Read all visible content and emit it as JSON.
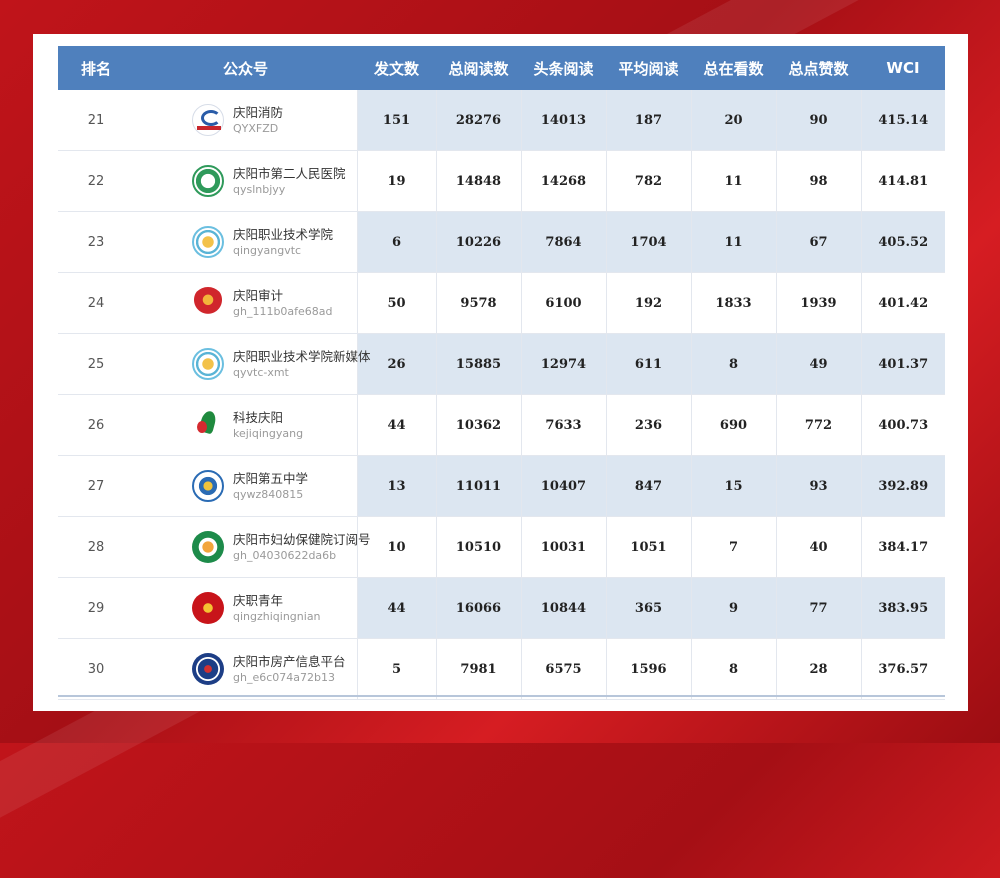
{
  "table": {
    "headers": {
      "rank": "排名",
      "account": "公众号",
      "posts": "发文数",
      "total_reads": "总阅读数",
      "headline_reads": "头条阅读",
      "avg_reads": "平均阅读",
      "total_watching": "总在看数",
      "total_likes": "总点赞数",
      "wci": "WCI"
    },
    "rows": [
      {
        "rank": "21",
        "name": "庆阳消防",
        "id": "QYXFZD",
        "posts": "151",
        "total_reads": "28276",
        "headline_reads": "14013",
        "avg_reads": "187",
        "total_watching": "20",
        "total_likes": "90",
        "wci": "415.14",
        "logo": "fire-dept-logo"
      },
      {
        "rank": "22",
        "name": "庆阳市第二人民医院",
        "id": "qyslnbjyy",
        "posts": "19",
        "total_reads": "14848",
        "headline_reads": "14268",
        "avg_reads": "782",
        "total_watching": "11",
        "total_likes": "98",
        "wci": "414.81",
        "logo": "hospital-logo"
      },
      {
        "rank": "23",
        "name": "庆阳职业技术学院",
        "id": "qingyangvtc",
        "posts": "6",
        "total_reads": "10226",
        "headline_reads": "7864",
        "avg_reads": "1704",
        "total_watching": "11",
        "total_likes": "67",
        "wci": "405.52",
        "logo": "college-logo"
      },
      {
        "rank": "24",
        "name": "庆阳审计",
        "id": "gh_111b0afe68ad",
        "posts": "50",
        "total_reads": "9578",
        "headline_reads": "6100",
        "avg_reads": "192",
        "total_watching": "1833",
        "total_likes": "1939",
        "wci": "401.42",
        "logo": "audit-logo"
      },
      {
        "rank": "25",
        "name": "庆阳职业技术学院新媒体",
        "id": "qyvtc-xmt",
        "posts": "26",
        "total_reads": "15885",
        "headline_reads": "12974",
        "avg_reads": "611",
        "total_watching": "8",
        "total_likes": "49",
        "wci": "401.37",
        "logo": "college-logo"
      },
      {
        "rank": "26",
        "name": "科技庆阳",
        "id": "kejiqingyang",
        "posts": "44",
        "total_reads": "10362",
        "headline_reads": "7633",
        "avg_reads": "236",
        "total_watching": "690",
        "total_likes": "772",
        "wci": "400.73",
        "logo": "tech-logo"
      },
      {
        "rank": "27",
        "name": "庆阳第五中学",
        "id": "qywz840815",
        "posts": "13",
        "total_reads": "11011",
        "headline_reads": "10407",
        "avg_reads": "847",
        "total_watching": "15",
        "total_likes": "93",
        "wci": "392.89",
        "logo": "school-logo"
      },
      {
        "rank": "28",
        "name": "庆阳市妇幼保健院订阅号",
        "id": "gh_04030622da6b",
        "posts": "10",
        "total_reads": "10510",
        "headline_reads": "10031",
        "avg_reads": "1051",
        "total_watching": "7",
        "total_likes": "40",
        "wci": "384.17",
        "logo": "maternal-hospital-logo"
      },
      {
        "rank": "29",
        "name": "庆职青年",
        "id": "qingzhiqingnian",
        "posts": "44",
        "total_reads": "16066",
        "headline_reads": "10844",
        "avg_reads": "365",
        "total_watching": "9",
        "total_likes": "77",
        "wci": "383.95",
        "logo": "youth-logo"
      },
      {
        "rank": "30",
        "name": "庆阳市房产信息平台",
        "id": "gh_e6c074a72b13",
        "posts": "5",
        "total_reads": "7981",
        "headline_reads": "6575",
        "avg_reads": "1596",
        "total_watching": "8",
        "total_likes": "28",
        "wci": "376.57",
        "logo": "housing-logo"
      }
    ]
  },
  "colors": {
    "header_bg": "#4f80bd",
    "row_shade": "#dce6f1",
    "background": "#c0141a"
  }
}
